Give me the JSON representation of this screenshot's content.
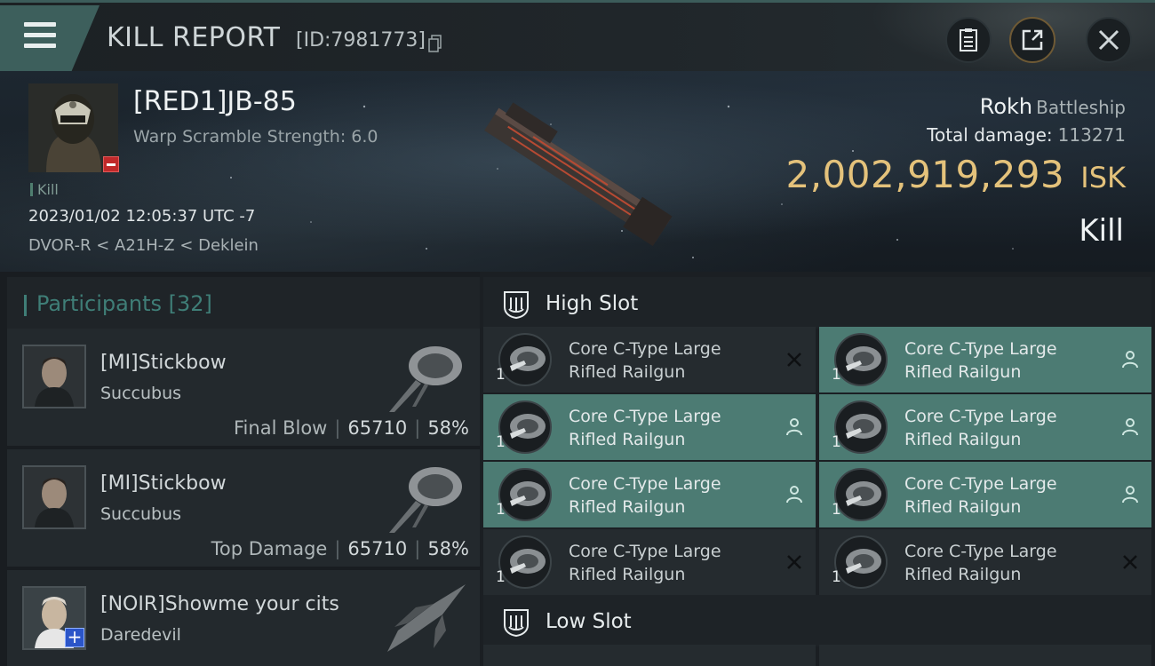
{
  "header": {
    "title": "KILL REPORT",
    "report_id": "[ID:7981773]",
    "buttons": [
      {
        "icon": "clipboard-icon"
      },
      {
        "icon": "share-icon"
      },
      {
        "icon": "close-icon"
      }
    ]
  },
  "victim": {
    "name": "[RED1]JB-85",
    "warp_scramble": "Warp Scramble Strength: 6.0",
    "tag": "Kill",
    "timestamp": "2023/01/02 12:05:37 UTC -7",
    "location": "DVOR-R < A21H-Z < Deklein",
    "ship_name": "Rokh",
    "ship_class": "Battleship",
    "total_damage_label": "Total damage:",
    "total_damage": "113271",
    "isk_value": "2,002,919,293",
    "isk_unit": "ISK",
    "result": "Kill"
  },
  "participants": {
    "title": "Participants",
    "count": "[32]",
    "items": [
      {
        "name": "[MI]Stickbow",
        "ship": "Succubus",
        "label": "Final Blow",
        "damage": "65710",
        "percent": "58%"
      },
      {
        "name": "[MI]Stickbow",
        "ship": "Succubus",
        "label": "Top Damage",
        "damage": "65710",
        "percent": "58%"
      },
      {
        "name": "[NOIR]Showme your cits",
        "ship": "Daredevil",
        "label": "",
        "damage": "",
        "percent": ""
      }
    ]
  },
  "slots": {
    "high": {
      "title": "High Slot",
      "modules": [
        {
          "line1": "Core C-Type Large",
          "line2": "Rifled Railgun",
          "qty": "1",
          "status": "destroyed",
          "active": false
        },
        {
          "line1": "Core C-Type Large",
          "line2": "Rifled Railgun",
          "qty": "1",
          "status": "dropped",
          "active": true
        },
        {
          "line1": "Core C-Type Large",
          "line2": "Rifled Railgun",
          "qty": "1",
          "status": "dropped",
          "active": true
        },
        {
          "line1": "Core C-Type Large",
          "line2": "Rifled Railgun",
          "qty": "1",
          "status": "dropped",
          "active": true
        },
        {
          "line1": "Core C-Type Large",
          "line2": "Rifled Railgun",
          "qty": "1",
          "status": "dropped",
          "active": true
        },
        {
          "line1": "Core C-Type Large",
          "line2": "Rifled Railgun",
          "qty": "1",
          "status": "dropped",
          "active": true
        },
        {
          "line1": "Core C-Type Large",
          "line2": "Rifled Railgun",
          "qty": "1",
          "status": "destroyed",
          "active": false
        },
        {
          "line1": "Core C-Type Large",
          "line2": "Rifled Railgun",
          "qty": "1",
          "status": "destroyed",
          "active": false
        }
      ]
    },
    "low": {
      "title": "Low Slot"
    }
  },
  "colors": {
    "accent": "#3f7e77",
    "active_cell": "#4c7b73",
    "isk": "#e4c27b",
    "destroyed_badge": "#c0292a"
  }
}
